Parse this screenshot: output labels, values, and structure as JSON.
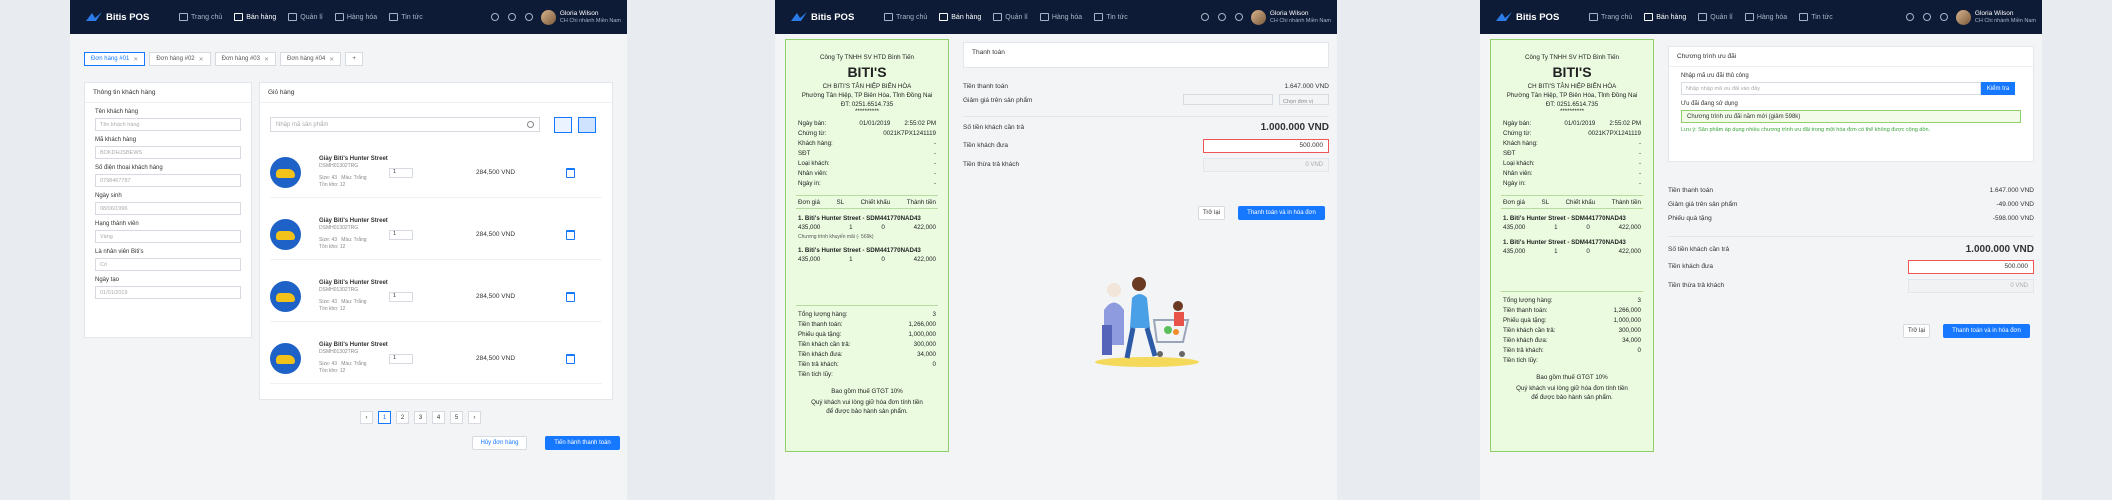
{
  "nav": {
    "logo": "Bitis POS",
    "menu": [
      "Trang chủ",
      "Bán hàng",
      "Quản lí",
      "Hàng hóa",
      "Tin tức"
    ],
    "active": "Bán hàng",
    "user_name": "Gloria Wilson",
    "user_branch": "CH Chi nhánh Miền Nam"
  },
  "orders": {
    "tabs": [
      "Đơn hàng #01",
      "Đơn hàng #02",
      "Đơn hàng #03",
      "Đơn hàng #04"
    ],
    "add": "+"
  },
  "customer": {
    "title": "Thông tin khách hàng",
    "fields": [
      {
        "label": "Tên khách hàng",
        "value": "Tên khách hàng"
      },
      {
        "label": "Mã khách hàng",
        "value": "BOKDHJSBEWS"
      },
      {
        "label": "Số điện thoại khách hàng",
        "value": "0798467787"
      },
      {
        "label": "Ngày sinh",
        "value": "08/06/1996"
      },
      {
        "label": "Hạng thành viên",
        "value": "Vàng"
      },
      {
        "label": "Là nhân viên Biti's",
        "value": "Có"
      },
      {
        "label": "Ngày tạo",
        "value": "01/01/2019"
      }
    ]
  },
  "cart": {
    "title": "Giỏ hàng",
    "search_placeholder": "Nhập mã sản phẩm",
    "items": [
      {
        "name": "Giày Biti's Hunter Street",
        "sku": "DSMH01302TRG",
        "size": "Size: 43",
        "color": "Màu: Trắng",
        "stock": "Tồn kho: 12",
        "qty": "1",
        "price": "284,500 VND"
      },
      {
        "name": "Giày Biti's Hunter Street",
        "sku": "DSMH01302TRG",
        "size": "Size: 43",
        "color": "Màu: Trắng",
        "stock": "Tồn kho: 12",
        "qty": "1",
        "price": "284,500 VND"
      },
      {
        "name": "Giày Biti's Hunter Street",
        "sku": "DSMH01302TRG",
        "size": "Size: 43",
        "color": "Màu: Trắng",
        "stock": "Tồn kho: 12",
        "qty": "1",
        "price": "284,500 VND"
      },
      {
        "name": "Giày Biti's Hunter Street",
        "sku": "DSMH01302TRG",
        "size": "Size: 43",
        "color": "Màu: Trắng",
        "stock": "Tồn kho: 12",
        "qty": "1",
        "price": "284,500 VND"
      }
    ],
    "pages": [
      "‹",
      "1",
      "2",
      "3",
      "4",
      "5",
      "›"
    ],
    "cancel": "Hủy đơn hàng",
    "checkout": "Tiến hành thanh toán"
  },
  "receipt": {
    "company": "Công Ty TNHH SV HTD Bình Tiến",
    "brand": "BITI'S",
    "store": "CH BITI'S TÂN HIỆP BIÊN HÒA",
    "address": "Phường Tân Hiệp, TP Biên Hòa, Tỉnh Đồng Nai",
    "phone": "ĐT: 0251.6514.735",
    "stars": "**********",
    "info": [
      {
        "k": "Ngày bán:",
        "v": "01/01/2019",
        "v2": "2:55:02 PM"
      },
      {
        "k": "Chứng từ:",
        "v": "",
        "v2": "0021K7PX1241119"
      },
      {
        "k": "Khách hàng:",
        "v": "",
        "v2": "-"
      },
      {
        "k": "SĐT",
        "v": "",
        "v2": "-"
      },
      {
        "k": "Loại khách:",
        "v": "",
        "v2": "-"
      },
      {
        "k": "Nhân viên:",
        "v": "",
        "v2": "-"
      },
      {
        "k": "Ngày in:",
        "v": "",
        "v2": "-"
      }
    ],
    "cols": [
      "Đơn giá",
      "SL",
      "Chiết khấu",
      "Thành tiền"
    ],
    "items": [
      {
        "name": "1. Biti's Hunter Street - SDM441770NAD43",
        "price": "435,000",
        "qty": "1",
        "disc": "0",
        "total": "422,000"
      },
      {
        "name": "1. Biti's Hunter Street - SDM441770NAD43",
        "price": "435,000",
        "qty": "1",
        "disc": "0",
        "total": "422,000"
      }
    ],
    "promo_note": "Chương trình khuyến mãi (- 569k)",
    "totals": [
      {
        "k": "Tổng lượng hàng:",
        "v": "3"
      },
      {
        "k": "Tiền thanh toán:",
        "v": "1,266,000"
      },
      {
        "k": "Phiếu quà tặng:",
        "v": "1,000,000"
      },
      {
        "k": "Tiền khách cần trả:",
        "v": "300,000"
      },
      {
        "k": "Tiền khách đưa:",
        "v": "34,000"
      },
      {
        "k": "Tiền trả khách:",
        "v": "0"
      },
      {
        "k": "Tiền tích lũy:",
        "v": ""
      }
    ],
    "vat": "Bao gồm thuế GTGT 10%",
    "note": "Quý khách vui lòng giữ hóa đơn tính tiền để được bảo hành sản phẩm."
  },
  "payment": {
    "title": "Thanh toán",
    "rows": [
      {
        "k": "Tiền thanh toán",
        "v": "1.647.000 VND"
      },
      {
        "k": "Giảm giá trên sản phẩm",
        "v": ""
      }
    ],
    "discount_unit": "Chọn đơn vị",
    "due_label": "Số tiền khách cần trả",
    "due_value": "1.000.000 VND",
    "given_label": "Tiền khách đưa",
    "given_value": "500.000",
    "change_label": "Tiền thừa trả khách",
    "change_value": "0 VND",
    "back": "Trở lại",
    "pay": "Thanh toán và in hóa đơn"
  },
  "promo": {
    "title": "Chương trình ưu đãi",
    "code_label": "Nhập mã ưu đãi thủ công",
    "code_placeholder": "Nhập nhập mã ưu đãi vào đây",
    "check": "Kiểm tra",
    "using_label": "Ưu đãi đang sử dụng",
    "using_value": "Chương trình ưu đãi năm mới (giảm 598k)",
    "warning": "Lưu ý: Sản phẩm áp dụng nhiều chương trình ưu đãi trong một hóa đơn có thể không được cộng dồn.",
    "rows": [
      {
        "k": "Tiền thanh toán",
        "v": "1.647.000 VND"
      },
      {
        "k": "Giảm giá trên sản phẩm",
        "v": "-49.000 VND"
      },
      {
        "k": "Phiếu quà tặng",
        "v": "-598.000 VND"
      }
    ]
  }
}
